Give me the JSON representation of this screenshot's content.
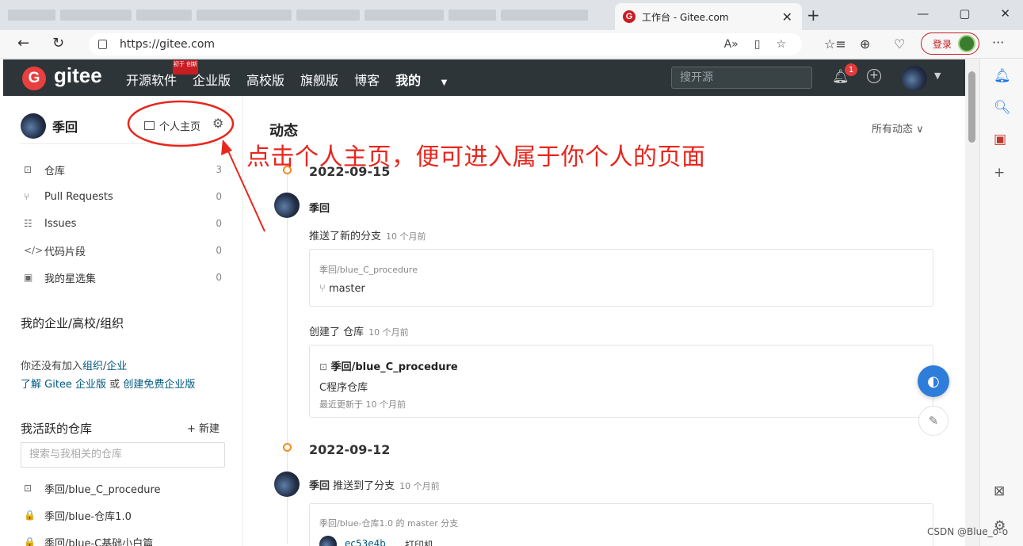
{
  "browser": {
    "tab_title": "工作台 - Gitee.com",
    "tab_logo": "G",
    "tab_close": "✕",
    "new_tab": "+",
    "win_min": "—",
    "win_max": "▢",
    "win_close": "✕",
    "url": "https://gitee.com",
    "login_label": "登录",
    "more": "···"
  },
  "header": {
    "logo_letter": "G",
    "brand": "gitee",
    "nav": [
      "开源软件",
      "企业版",
      "高校版",
      "旗舰版",
      "博客"
    ],
    "mine": "我的",
    "badge": "初于 创新",
    "search_placeholder": "搜开源",
    "notification_count": "1"
  },
  "sidebar": {
    "user_name": "季回",
    "homepage_label": "个人主页",
    "menu": [
      {
        "icon": "repo-icon",
        "glyph": "⊡",
        "label": "仓库",
        "count": "3"
      },
      {
        "icon": "pull-request-icon",
        "glyph": "⑂",
        "label": "Pull Requests",
        "count": "0"
      },
      {
        "icon": "issues-icon",
        "glyph": "☷",
        "label": "Issues",
        "count": "0"
      },
      {
        "icon": "code-snippet-icon",
        "glyph": "</>",
        "label": "代码片段",
        "count": "0"
      },
      {
        "icon": "star-collection-icon",
        "glyph": "▣",
        "label": "我的星选集",
        "count": "0"
      }
    ],
    "org_title": "我的企业/高校/组织",
    "org_line1_prefix": "你还没有加入",
    "org_link_org": "组织",
    "org_slash": "/",
    "org_link_ent": "企业",
    "org_line2_link1": "了解 Gitee 企业版",
    "org_line2_or": " 或 ",
    "org_line2_link2": "创建免费企业版",
    "active_repos_title": "我活跃的仓库",
    "new_label": "+ 新建",
    "repo_search_placeholder": "搜索与我相关的仓库",
    "repos": [
      {
        "glyph": "⊡",
        "label": "季回/blue_C_procedure"
      },
      {
        "glyph": "🔒",
        "label": "季回/blue-仓库1.0"
      },
      {
        "glyph": "🔒",
        "label": "季回/blue-C基础小白篇"
      }
    ]
  },
  "feed": {
    "title": "动态",
    "filter": "所有动态 ∨",
    "day1": {
      "date": "2022-09-15",
      "user": "季回",
      "action1": "推送了新的分支",
      "ago1": "10 个月前",
      "card1_repo_path": "季回/blue_C_procedure",
      "card1_branch": "master",
      "action2": "创建了 仓库",
      "ago2": "10 个月前",
      "card2_repo": "季回/blue_C_procedure",
      "card2_desc": "C程序仓库",
      "card2_updated": "最近更新于 10 个月前"
    },
    "day2": {
      "date": "2022-09-12",
      "user": "季回",
      "action": "推送到了分支",
      "ago": "10 个月前",
      "card_sub": "季回/blue-仓库1.0 的 master 分支",
      "commit_sha": "ec53e4b",
      "commit_msg": "打印机"
    }
  },
  "annotation": {
    "text": "点击个人主页，便可进入属于你个人的页面",
    "color": "#e8261d"
  },
  "watermark": "CSDN @Blue_o-o"
}
